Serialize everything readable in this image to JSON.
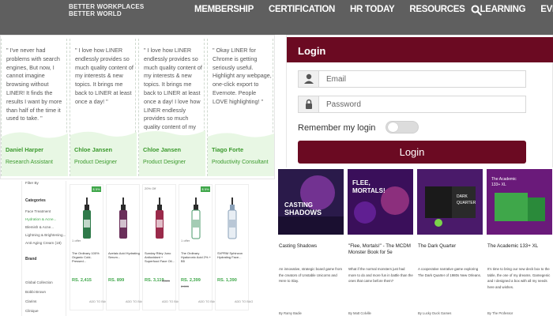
{
  "nav": {
    "brand_line1": "BETTER WORKPLACES",
    "brand_line2": "BETTER WORLD",
    "links": [
      "MEMBERSHIP",
      "CERTIFICATION",
      "HR TODAY",
      "RESOURCES",
      "LEARNING",
      "EVENTS"
    ],
    "search_icon": "search-icon"
  },
  "testimonials": [
    {
      "quote": "\" I've never had problems with search engines, But now, I cannot imagine browsing without LINER! It finds the results I want by more than half of the time it used to take. \"",
      "name": "Daniel Harper",
      "role": "Research Assistant"
    },
    {
      "quote": "\" I love how LINER endlessly provides so much quality content of my interests & new topics. It brings me back to LINER at least once a day! \"",
      "name": "Chloe Jansen",
      "role": "Product Designer"
    },
    {
      "quote": "\" I love how LINER endlessly provides so much quality content of my interests & new topics. It brings me back to LINER at least once a day! I love how LINER endlessly provides so much quality content of my",
      "name": "Chloe Jansen",
      "role": "Product Designer"
    },
    {
      "quote": "\" Okay LINER for Chrome is getting seriously useful. Highlight any webpage, one-click export to Evernote. People LOVE highlighting! \"",
      "name": "Tiago Forte",
      "role": "Productivity Consultant"
    }
  ],
  "login": {
    "title": "Login",
    "email_placeholder": "Email",
    "password_placeholder": "Password",
    "remember_label": "Remember my login",
    "remember_on": false,
    "button_label": "Login",
    "accent": "#6b0a22"
  },
  "shop": {
    "sidebar": {
      "sort": "Filter By",
      "categories_heading": "Categories",
      "categories": [
        "Face Treatment",
        "Hydration & Acne...",
        "Blemish & Acne...",
        "Lightning & Brightening...",
        "Anti-Aging Cream (18)"
      ],
      "brand_heading": "Brand",
      "brands": [
        "Global Collection",
        "Bobbi Brown",
        "Clarins",
        "Clinique"
      ]
    },
    "products": [
      {
        "badge": "$ 5%",
        "meta": "1 offer",
        "name": "The Ordinary 100% Organic Cold-Pressed...",
        "price": "RS. 2,415",
        "old": "",
        "cart": "ADD TO BAG",
        "color": "#2f7a4a"
      },
      {
        "badge": "",
        "meta": "",
        "name": "Azelaic Acid Hydrating Serum...",
        "price": "RS. 899",
        "old": "",
        "cart": "ADD TO BAG",
        "color": "#6a2f5a"
      },
      {
        "badge": "",
        "meta": "20% Off",
        "name": "Sunday Riley Juno Antioxidant + Superfood Face Oil...",
        "price": "RS. 3,119",
        "old": "3,899",
        "cart": "ADD TO BAG",
        "color": "#9a2a4a"
      },
      {
        "badge": "$ 5%",
        "meta": "1 offer",
        "name": "The Ordinary Hyaluronic Acid 2% + B5",
        "price": "RS. 2,399",
        "old": "2,599",
        "cart": "ADD TO BAG",
        "color": "#4a9a6a"
      },
      {
        "badge": "",
        "meta": "",
        "name": "SVPRM Sphinzon Hydrating Face...",
        "price": "RS. 1,390",
        "old": "",
        "cart": "ADD TO BAG",
        "color": "#8aa0b8"
      }
    ]
  },
  "games": [
    {
      "title": "Casting Shadows",
      "desc": "An innovative, strategic board game from the creators of Unstable Unicorns and Here to Slay.",
      "by": "By Ramy Badie",
      "bg": "#2a1a4a",
      "accent": "#b94ad8"
    },
    {
      "title": "\"Flee, Mortals!\" - The MCDM Monster Book for 5e",
      "desc": "What if the normal monsters just had more to do and more fun in battle than the ones that came before them?",
      "by": "By Matt Colville",
      "bg": "#3a0f5a",
      "accent": "#d04a9a"
    },
    {
      "title": "The Dark Quarter",
      "desc": "A cooperative narrative game exploring The Dark Quarter of 1980s New Orleans.",
      "by": "By Lucky Duck Games",
      "bg": "#4a1a6a",
      "accent": "#7ad34a"
    },
    {
      "title": "The Academic 133+ XL",
      "desc": "It's time to bring our new deck box to the table, the one of my dreams. Gamegenic and I designed a box with all my needs here and wishes.",
      "by": "By The Professor",
      "bg": "#6a1a7a",
      "accent": "#3fa74a"
    }
  ]
}
